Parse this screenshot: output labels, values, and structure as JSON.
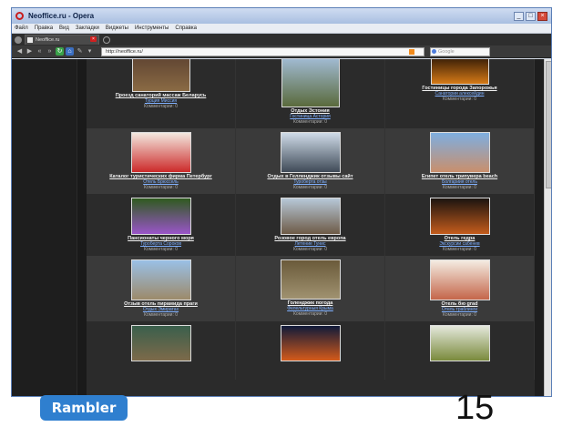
{
  "window": {
    "title": "Neoffice.ru - Opera"
  },
  "menu": [
    "Файл",
    "Правка",
    "Вид",
    "Закладки",
    "Виджеты",
    "Инструменты",
    "Справка"
  ],
  "tab": {
    "label": "Neoffice.ru"
  },
  "address": {
    "url": "http://neoffice.ru/",
    "search_placeholder": "Google"
  },
  "rows": [
    {
      "alt": false,
      "cells": [
        {
          "title": "Проезд санаторий массаж Беларусь",
          "sub": "Турция Миссия",
          "comments": "Комментарии: 0",
          "top_color": "#5b4030",
          "bottom_color": "#8a6a44"
        },
        {
          "title": "Отдых Эстония",
          "sub": "Гостиница Астория",
          "comments": "Комментарии: 0",
          "top_color": "#a9c4e4",
          "bottom_color": "#5a6a3c"
        },
        {
          "title": "Гостиницы города Запорожья",
          "sub": "Санатории алексейдин",
          "comments": "Комментарии: 0",
          "top_color": "#1a0c04",
          "bottom_color": "#d57a16"
        }
      ]
    },
    {
      "alt": true,
      "cells": [
        {
          "title": "Каталог туристических фирма Петербург",
          "sub": "Отель Брюссель",
          "comments": "Комментарии: 0",
          "top_color": "#f3e8df",
          "bottom_color": "#cc2a2a"
        },
        {
          "title": "Отдых в Гелленджик отзывы сайт",
          "sub": "Туроберта отзы",
          "comments": "Комментарии: 0",
          "top_color": "#cfdbe8",
          "bottom_color": "#3f4a57"
        },
        {
          "title": "Египет отель трипувера beach",
          "sub": "Болгариия отель",
          "comments": "Комментарии: 0",
          "top_color": "#7eaee0",
          "bottom_color": "#c98f6c"
        }
      ]
    },
    {
      "alt": false,
      "cells": [
        {
          "title": "Пансионаты черного моря",
          "sub": "Туроберта Сороков",
          "comments": "Комментарии: 0",
          "top_color": "#2f5a1e",
          "bottom_color": "#9a55c9"
        },
        {
          "title": "Розовое город отель европа",
          "sub": "Летение Тунис",
          "comments": "Комментарии: 0",
          "top_color": "#b7c8d8",
          "bottom_color": "#6e5b47"
        },
        {
          "title": "Отель гедра",
          "sub": "Экскурсии сабенев",
          "comments": "Комментарии: 0",
          "top_color": "#1b1410",
          "bottom_color": "#c45c1c"
        }
      ]
    },
    {
      "alt": true,
      "cells": [
        {
          "title": "Отзыв отель пирамида праги",
          "sub": "Отдых Эмиратах",
          "comments": "Комментарии: 0",
          "top_color": "#9ac0e6",
          "bottom_color": "#9c8a6a"
        },
        {
          "title": "Голенджик погода",
          "sub": "Фелельтурныя Крыма",
          "comments": "Комментарии: 0",
          "top_color": "#6a5a3a",
          "bottom_color": "#a09270"
        },
        {
          "title": "Отель бю grad",
          "sub": "Отель траблинги",
          "comments": "Комментарии: 0",
          "top_color": "#f4ece2",
          "bottom_color": "#c4664a"
        }
      ]
    },
    {
      "alt": false,
      "cells": [
        {
          "title": "",
          "sub": "",
          "comments": "",
          "top_color": "#3a5f4c",
          "bottom_color": "#7d6a4a"
        },
        {
          "title": "",
          "sub": "",
          "comments": "",
          "top_color": "#0f1a3a",
          "bottom_color": "#d45a1a"
        },
        {
          "title": "",
          "sub": "",
          "comments": "",
          "top_color": "#e4e8dc",
          "bottom_color": "#7a8a3c"
        }
      ]
    }
  ],
  "footer": {
    "logo_text": "Rambler",
    "page_number": "15"
  }
}
